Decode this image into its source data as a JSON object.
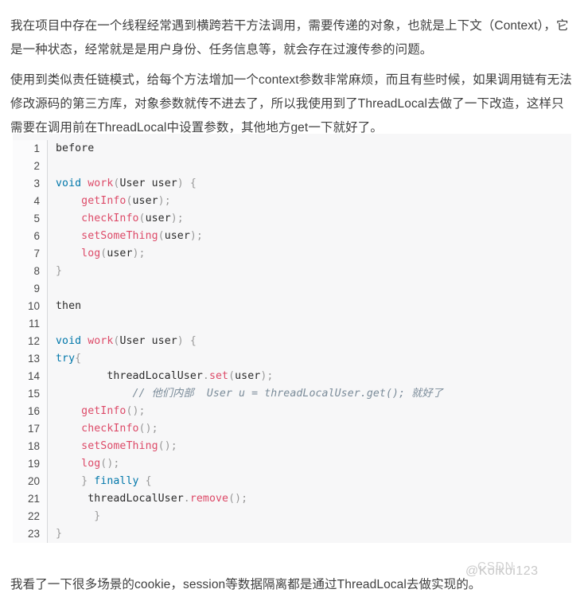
{
  "article": {
    "paragraph_1": "我在项目中存在一个线程经常遇到横跨若干方法调用，需要传递的对象，也就是上下文（Context），它是一种状态，经常就是是用户身份、任务信息等，就会存在过渡传参的问题。",
    "paragraph_2": "使用到类似责任链模式，给每个方法增加一个context参数非常麻烦，而且有些时候，如果调用链有无法修改源码的第三方库，对象参数就传不进去了，所以我使用到了ThreadLocal去做了一下改造，这样只需要在调用前在ThreadLocal中设置参数，其他地方get一下就好了。",
    "paragraph_3": "我看了一下很多场景的cookie，session等数据隔离都是通过ThreadLocal去做实现的。"
  },
  "code_block": {
    "language": "java",
    "line_numbers": [
      1,
      2,
      3,
      4,
      5,
      6,
      7,
      8,
      9,
      10,
      11,
      12,
      13,
      14,
      15,
      16,
      17,
      18,
      19,
      20,
      21,
      22,
      23
    ],
    "lines": [
      "before",
      "",
      "void work(User user) {",
      "    getInfo(user);",
      "    checkInfo(user);",
      "    setSomeThing(user);",
      "    log(user);",
      "}",
      "",
      "then",
      "",
      "void work(User user) {",
      "try{",
      "        threadLocalUser.set(user);",
      "      // 他们内部  User u = threadLocalUser.get(); 就好了",
      "    getInfo();",
      "    checkInfo();",
      "    setSomeThing();",
      "    log();",
      "    } finally {",
      "     threadLocalUser.remove();",
      "      }",
      "}"
    ]
  },
  "watermark": {
    "brand": "CSDN",
    "handle": "@Koikoi123"
  },
  "colors": {
    "keyword": "#0077aa",
    "function": "#dd4a68",
    "punctuation": "#999999",
    "comment": "#7a8b99",
    "code_background": "#f7f7f8",
    "gutter_background": "#fbfbfc",
    "text": "#3f3f3f"
  }
}
